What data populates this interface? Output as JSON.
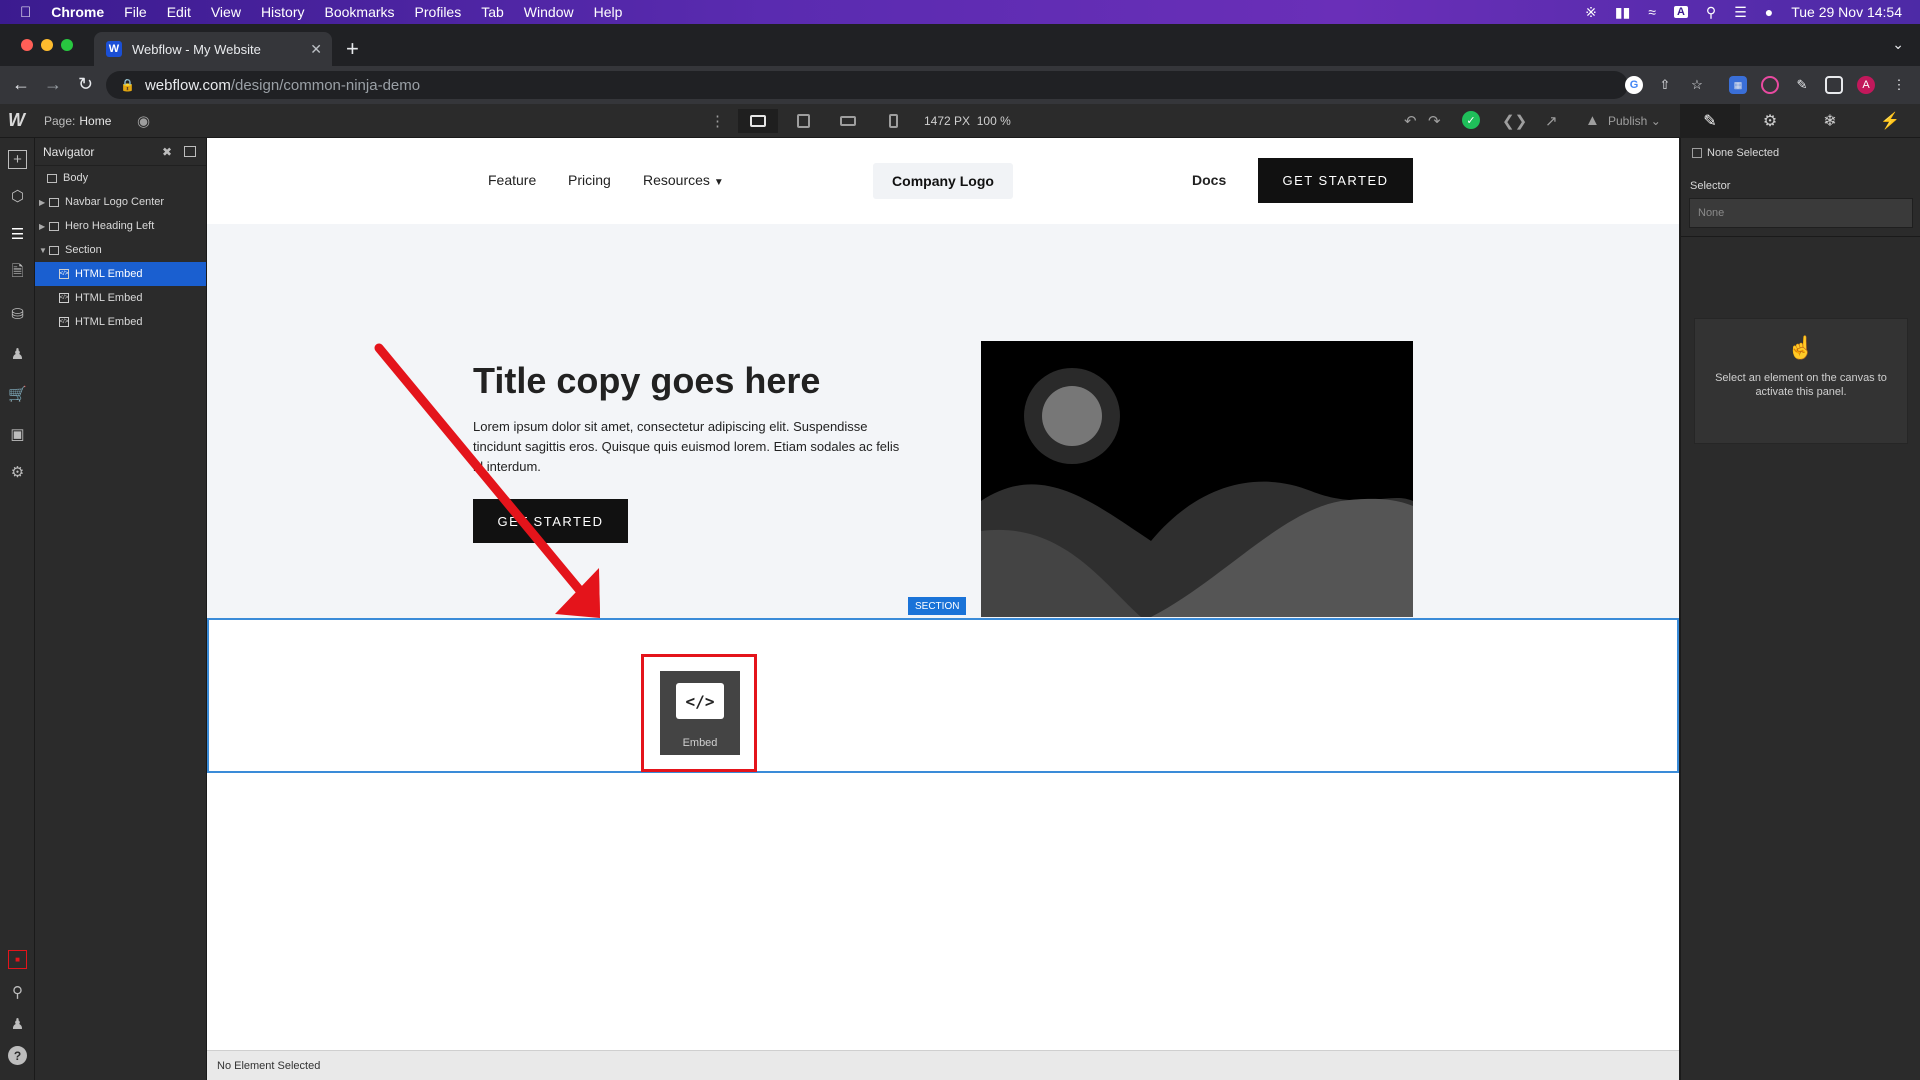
{
  "menubar": {
    "app": "Chrome",
    "items": [
      "File",
      "Edit",
      "View",
      "History",
      "Bookmarks",
      "Profiles",
      "Tab",
      "Window",
      "Help"
    ],
    "datetime": "Tue 29 Nov  14:54"
  },
  "browser": {
    "tab_title": "Webflow - My Website",
    "url_host": "webflow.com",
    "url_path": "/design/common-ninja-demo",
    "profile_initial": "A"
  },
  "designer": {
    "page_label": "Page:",
    "page_name": "Home",
    "canvas_width": "1472 PX",
    "zoom": "100 %",
    "publish_label": "Publish"
  },
  "navigator": {
    "title": "Navigator",
    "tree": [
      {
        "label": "Body",
        "level": 0,
        "kind": "box"
      },
      {
        "label": "Navbar Logo Center",
        "level": 1,
        "kind": "box"
      },
      {
        "label": "Hero Heading Left",
        "level": 1,
        "kind": "box"
      },
      {
        "label": "Section",
        "level": 1,
        "kind": "box"
      },
      {
        "label": "HTML Embed",
        "level": 2,
        "kind": "embed",
        "selected": true
      },
      {
        "label": "HTML Embed",
        "level": 2,
        "kind": "embed"
      },
      {
        "label": "HTML Embed",
        "level": 2,
        "kind": "embed"
      }
    ]
  },
  "site": {
    "nav_links": [
      "Feature",
      "Pricing",
      "Resources"
    ],
    "logo": "Company Logo",
    "docs": "Docs",
    "cta": "GET STARTED",
    "hero_title": "Title copy goes here",
    "hero_body": "Lorem ipsum dolor sit amet, consectetur adipiscing elit. Suspendisse tincidunt sagittis eros. Quisque quis euismod lorem. Etiam sodales ac felis id interdum.",
    "hero_cta": "GET STARTED",
    "section_tag": "SECTION",
    "embed_label": "Embed",
    "embed_glyph": "</>"
  },
  "right_panel": {
    "none_selected": "None Selected",
    "selector_label": "Selector",
    "selector_placeholder": "None",
    "hint": "Select an element on the canvas to activate this panel."
  },
  "status": {
    "text": "No Element Selected"
  },
  "colors": {
    "selection_blue": "#1a5fd0",
    "highlight_red": "#e4141b",
    "publish_ok": "#1fbf5a"
  }
}
